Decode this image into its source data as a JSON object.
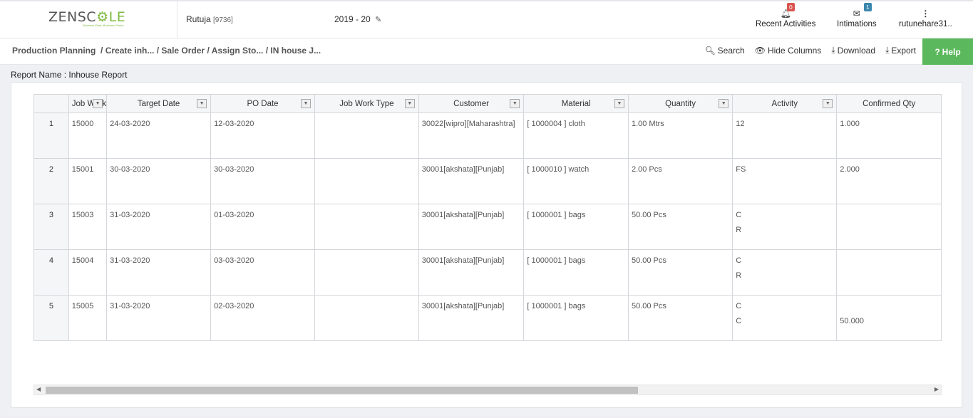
{
  "header": {
    "logo_left": "ZENSC",
    "logo_mid": "⚙",
    "logo_right": "LE",
    "logo_tagline": "Business Ease. Business Peace.",
    "user_name": "Rutuja",
    "user_id": "[9736]",
    "fiscal_year": "2019 - 20",
    "recent_activities_label": "Recent Activities",
    "recent_activities_count": "0",
    "intimations_label": "Intimations",
    "intimations_count": "1",
    "username": "rutunehare31.."
  },
  "breadcrumb": {
    "root": "Production Planning",
    "items": [
      "Create inh...",
      "Sale Order",
      "Assign Sto...",
      "IN house J..."
    ]
  },
  "actions": {
    "search": "Search",
    "hide_columns": "Hide Columns",
    "download": "Download",
    "export": "Export",
    "help": "Help"
  },
  "report": {
    "label": "Report Name : Inhouse Report"
  },
  "table": {
    "columns": [
      "Job Work",
      "Target Date",
      "PO Date",
      "Job Work Type",
      "Customer",
      "Material",
      "Quantity",
      "Activity",
      "Confirmed Qty"
    ],
    "rows": [
      {
        "num": "1",
        "job": "15000",
        "target": "24-03-2020",
        "po": "12-03-2020",
        "type": "",
        "customer": "30022[wipro][Maharashtra]",
        "material": "[ 1000004 ] cloth",
        "qty": "1.00 Mtrs",
        "activity": [
          "12"
        ],
        "confirmed": [
          "1.000"
        ]
      },
      {
        "num": "2",
        "job": "15001",
        "target": "30-03-2020",
        "po": "30-03-2020",
        "type": "",
        "customer": "30001[akshata][Punjab]",
        "material": "[ 1000010 ] watch",
        "qty": "2.00 Pcs",
        "activity": [
          "FS"
        ],
        "confirmed": [
          "2.000"
        ]
      },
      {
        "num": "3",
        "job": "15003",
        "target": "31-03-2020",
        "po": "01-03-2020",
        "type": "",
        "customer": "30001[akshata][Punjab]",
        "material": "[ 1000001 ] bags",
        "qty": "50.00 Pcs",
        "activity": [
          "C",
          "R"
        ],
        "confirmed": []
      },
      {
        "num": "4",
        "job": "15004",
        "target": "31-03-2020",
        "po": "03-03-2020",
        "type": "",
        "customer": "30001[akshata][Punjab]",
        "material": "[ 1000001 ] bags",
        "qty": "50.00 Pcs",
        "activity": [
          "C",
          "R"
        ],
        "confirmed": []
      },
      {
        "num": "5",
        "job": "15005",
        "target": "31-03-2020",
        "po": "02-03-2020",
        "type": "",
        "customer": "30001[akshata][Punjab]",
        "material": "[ 1000001 ] bags",
        "qty": "50.00 Pcs",
        "activity": [
          "C",
          "C"
        ],
        "confirmed": [
          "",
          "50.000"
        ]
      }
    ]
  }
}
